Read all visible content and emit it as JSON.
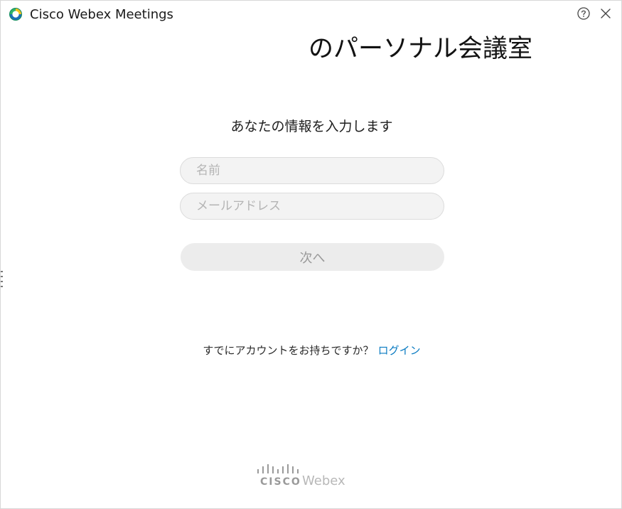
{
  "titlebar": {
    "app_title": "Cisco Webex Meetings",
    "logo_icon": "webex-logo-icon",
    "help_icon": "help-icon",
    "close_icon": "close-icon"
  },
  "main": {
    "room_title": "のパーソナル会議室",
    "subtitle": "あなたの情報を入力します",
    "name_placeholder": "名前",
    "email_placeholder": "メールアドレス",
    "next_label": "次へ",
    "login_prompt": "すでにアカウントをお持ちですか？",
    "login_link": "ログイン"
  },
  "footer": {
    "cisco_word": "CISCO",
    "webex_word": "Webex"
  },
  "colors": {
    "link": "#0a7bc2",
    "field_bg": "#f3f3f3",
    "button_bg": "#ececec",
    "logo_gray": "#9a9a9a"
  }
}
